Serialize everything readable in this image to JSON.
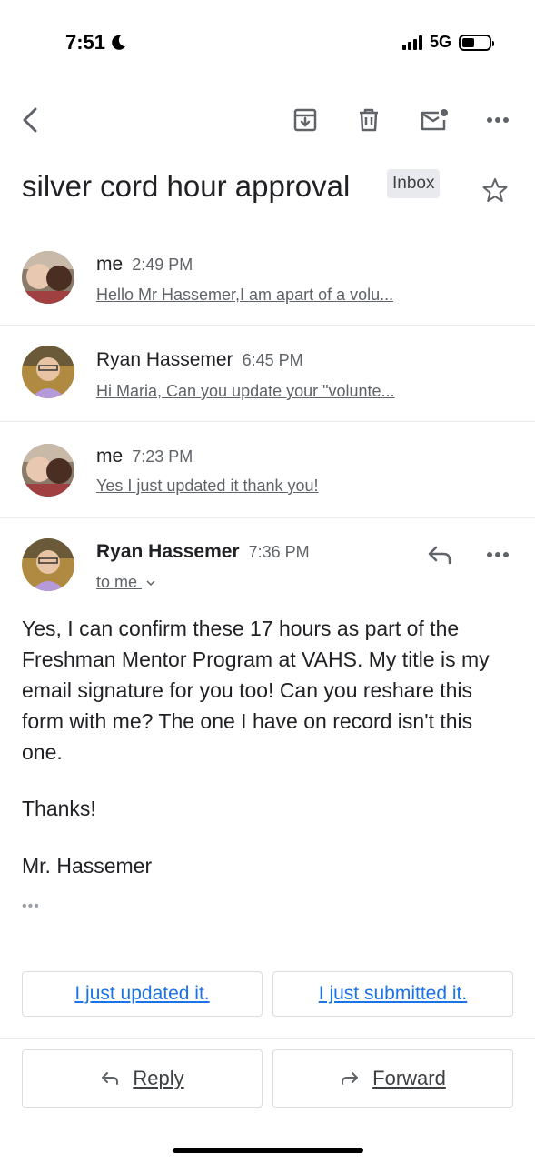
{
  "status": {
    "time": "7:51",
    "network": "5G",
    "battery_level": 0.45
  },
  "thread": {
    "subject": "silver cord hour approval",
    "label": "Inbox"
  },
  "messages": [
    {
      "sender": "me",
      "time": "2:49 PM",
      "snippet": "Hello Mr Hassemer,I am apart of a volu..."
    },
    {
      "sender": "Ryan Hassemer",
      "time": "6:45 PM",
      "snippet": "Hi Maria, Can you update your \"volunte..."
    },
    {
      "sender": "me",
      "time": "7:23 PM",
      "snippet": "Yes I just updated it thank you!"
    }
  ],
  "open_message": {
    "sender": "Ryan Hassemer",
    "time": "7:36 PM",
    "recipient": "to me",
    "body": "Yes, I can confirm these 17 hours as part of the Freshman Mentor Program at VAHS. My title is my email signature for you too! Can you reshare this form with me? The one I have on record isn't this one.",
    "closing": "Thanks!",
    "signature": "Mr. Hassemer"
  },
  "smart_replies": [
    "I just updated it.",
    "I just submitted it."
  ],
  "actions": {
    "reply": "Reply",
    "forward": "Forward"
  },
  "colors": {
    "link_blue": "#1a73e8",
    "chip_bg": "#e8eaed",
    "text": "#202124",
    "muted": "#5f6368"
  },
  "icons": [
    "back-icon",
    "archive-icon",
    "trash-icon",
    "mark-unread-icon",
    "more-icon",
    "star-icon",
    "reply-icon",
    "forward-icon",
    "chevron-down-icon",
    "moon-icon"
  ]
}
